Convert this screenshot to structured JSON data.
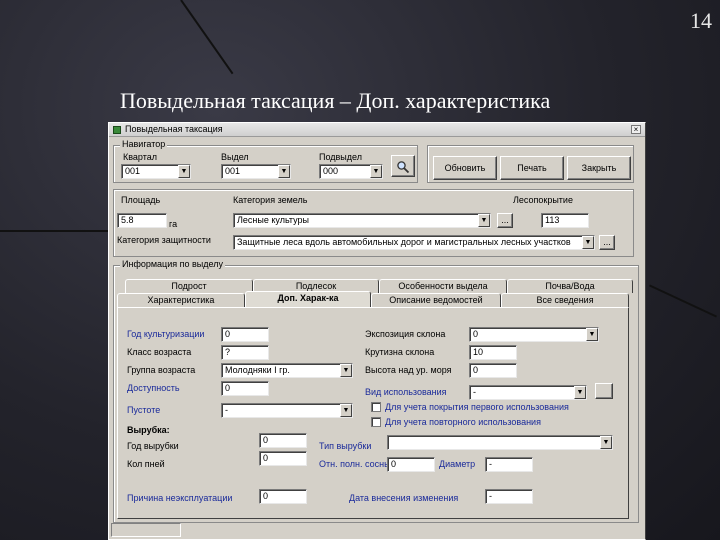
{
  "slide": {
    "number": "14",
    "title": "Повыдельная таксация – Доп. характеристика"
  },
  "window": {
    "title": "Повыдельная таксация",
    "close": "×"
  },
  "navigator": {
    "label": "Навигатор",
    "kvartal_label": "Квартал",
    "kvartal_value": "001",
    "vydel_label": "Выдел",
    "vydel_value": "001",
    "podvydel_label": "Подвыдел",
    "podvydel_value": "000",
    "search_icon": "magnifier-icon"
  },
  "actions": {
    "update": "Обновить",
    "print": "Печать",
    "save": "Закрыть"
  },
  "area": {
    "ploshad_label": "Площадь",
    "ploshad_value": "5.8",
    "unit": "га",
    "category_label": "Категория земель",
    "category_value": "Лесные культуры",
    "forest_label": "Лесопокрытие",
    "forest_value": "113",
    "protect_label": "Категория защитности",
    "protect_value": "Защитные леса вдоль автомобильных дорог и магистральных лесных участков",
    "dots": "..."
  },
  "info": {
    "label": "Информация по выделу",
    "tabs_back": [
      "Подрост",
      "Подлесок",
      "Особенности выдела",
      "Почва/Вода"
    ],
    "tabs_front": [
      "Характеристика",
      "Доп. Харак-ка",
      "Описание ведомостей",
      "Все сведения"
    ]
  },
  "form": {
    "god_label": "Год культуризации",
    "god_value": "0",
    "klass_label": "Класс возраста",
    "klass_value": "?",
    "gruppa_label": "Группа возраста",
    "gruppa_value": "Молодняки I гр.",
    "dostupnost_label": "Доступность",
    "dostupnost_value": "0",
    "pusto_label": "Пустоте",
    "pusto_value": "-",
    "ekspo_label": "Экспозиция склона",
    "ekspo_value": "0",
    "krut_label": "Крутизна склона",
    "krut_value": "10",
    "vys_label": "Высота над ур. моря",
    "vys_value": "0",
    "vid_label": "Вид использования",
    "vid_value": "-",
    "chk1_label": "Для учета покрытия первого использования",
    "chk2_label": "Для учета повторного использования",
    "vyrubka_label": "Вырубка:",
    "god_vyr_label": "Год вырубки",
    "god_vyr_value": "0",
    "pni_label": "Кол пней",
    "pni_value": "0",
    "tip_label": "Тип вырубки",
    "tip_value": "",
    "otn_label": "Отн. полн. сосны",
    "otn_value": "0",
    "diam_label": "Диаметр",
    "diam_value": "-",
    "prim_label": "Причина неэксплуатации",
    "prim_value": "0",
    "data_label": "Дата внесения изменения",
    "data_value": "-"
  }
}
